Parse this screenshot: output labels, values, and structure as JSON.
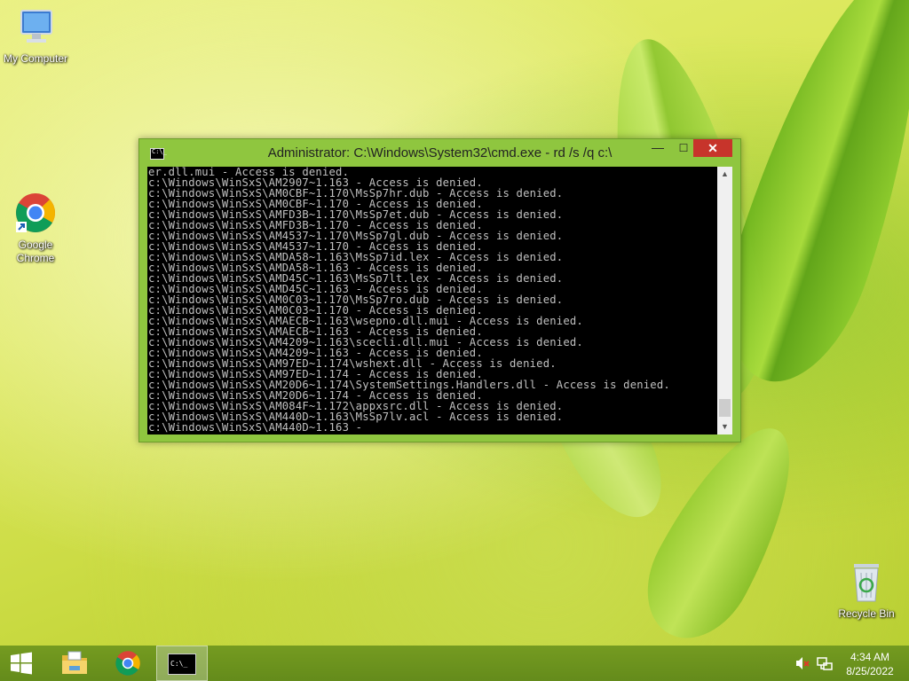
{
  "desktop": {
    "icons": [
      {
        "label": "My Computer",
        "icon": "computer-icon"
      },
      {
        "label": "Google Chrome",
        "icon": "chrome-icon"
      },
      {
        "label": "Recycle Bin",
        "icon": "recycle-bin-icon"
      }
    ]
  },
  "cmd_window": {
    "title": "Administrator: C:\\Windows\\System32\\cmd.exe - rd  /s /q c:\\",
    "minimize": "—",
    "maximize": "☐",
    "close": "✕",
    "lines": [
      "er.dll.mui - Access is denied.",
      "c:\\Windows\\WinSxS\\AM2907~1.163 - Access is denied.",
      "c:\\Windows\\WinSxS\\AM0CBF~1.170\\MsSp7hr.dub - Access is denied.",
      "c:\\Windows\\WinSxS\\AM0CBF~1.170 - Access is denied.",
      "c:\\Windows\\WinSxS\\AMFD3B~1.170\\MsSp7et.dub - Access is denied.",
      "c:\\Windows\\WinSxS\\AMFD3B~1.170 - Access is denied.",
      "c:\\Windows\\WinSxS\\AM4537~1.170\\MsSp7gl.dub - Access is denied.",
      "c:\\Windows\\WinSxS\\AM4537~1.170 - Access is denied.",
      "c:\\Windows\\WinSxS\\AMDA58~1.163\\MsSp7id.lex - Access is denied.",
      "c:\\Windows\\WinSxS\\AMDA58~1.163 - Access is denied.",
      "c:\\Windows\\WinSxS\\AMD45C~1.163\\MsSp7lt.lex - Access is denied.",
      "c:\\Windows\\WinSxS\\AMD45C~1.163 - Access is denied.",
      "c:\\Windows\\WinSxS\\AM0C03~1.170\\MsSp7ro.dub - Access is denied.",
      "c:\\Windows\\WinSxS\\AM0C03~1.170 - Access is denied.",
      "c:\\Windows\\WinSxS\\AMAECB~1.163\\wsepno.dll.mui - Access is denied.",
      "c:\\Windows\\WinSxS\\AMAECB~1.163 - Access is denied.",
      "c:\\Windows\\WinSxS\\AM4209~1.163\\scecli.dll.mui - Access is denied.",
      "c:\\Windows\\WinSxS\\AM4209~1.163 - Access is denied.",
      "c:\\Windows\\WinSxS\\AM97ED~1.174\\wshext.dll - Access is denied.",
      "c:\\Windows\\WinSxS\\AM97ED~1.174 - Access is denied.",
      "c:\\Windows\\WinSxS\\AM20D6~1.174\\SystemSettings.Handlers.dll - Access is denied.",
      "c:\\Windows\\WinSxS\\AM20D6~1.174 - Access is denied.",
      "c:\\Windows\\WinSxS\\AM084F~1.172\\appxsrc.dll - Access is denied.",
      "c:\\Windows\\WinSxS\\AM440D~1.163\\MsSp7lv.acl - Access is denied.",
      "c:\\Windows\\WinSxS\\AM440D~1.163 -"
    ]
  },
  "taskbar": {
    "items": [
      "start-icon",
      "file-explorer-icon",
      "chrome-icon",
      "cmd-icon"
    ],
    "cmd_icon_text": "C:\\_"
  },
  "tray": {
    "time": "4:34 AM",
    "date": "8/25/2022"
  }
}
